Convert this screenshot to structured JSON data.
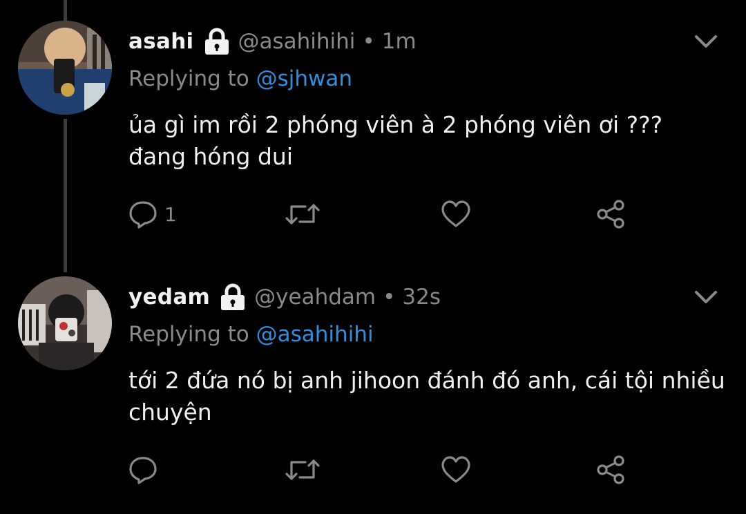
{
  "tweets": [
    {
      "name": "asahi",
      "handle": "@asahihihi",
      "separator": "•",
      "time": "1m",
      "replying_prefix": "Replying to",
      "replying_to": "@sjhwan",
      "text_line1": "ủa gì im rồi 2 phóng viên à 2 phóng viên ơi ???",
      "text_line2": "đang hóng dui",
      "reply_count": "1",
      "icons": [
        "reply-icon",
        "retweet-icon",
        "like-icon",
        "share-icon"
      ]
    },
    {
      "name": "yedam",
      "handle": "@yeahdam",
      "separator": "•",
      "time": "32s",
      "replying_prefix": "Replying to",
      "replying_to": "@asahihihi",
      "text_line1": "tới 2 đứa nó bị anh jihoon đánh đó anh, cái tội nhiều",
      "text_line2": "chuyện",
      "reply_count": "",
      "icons": [
        "reply-icon",
        "retweet-icon",
        "like-icon",
        "share-icon"
      ]
    }
  ],
  "colors": {
    "background": "#000000",
    "text": "#f0f0f0",
    "secondary": "#8a8a8a",
    "mention": "#2f8fdf",
    "thread_line": "#3d3d3d"
  }
}
